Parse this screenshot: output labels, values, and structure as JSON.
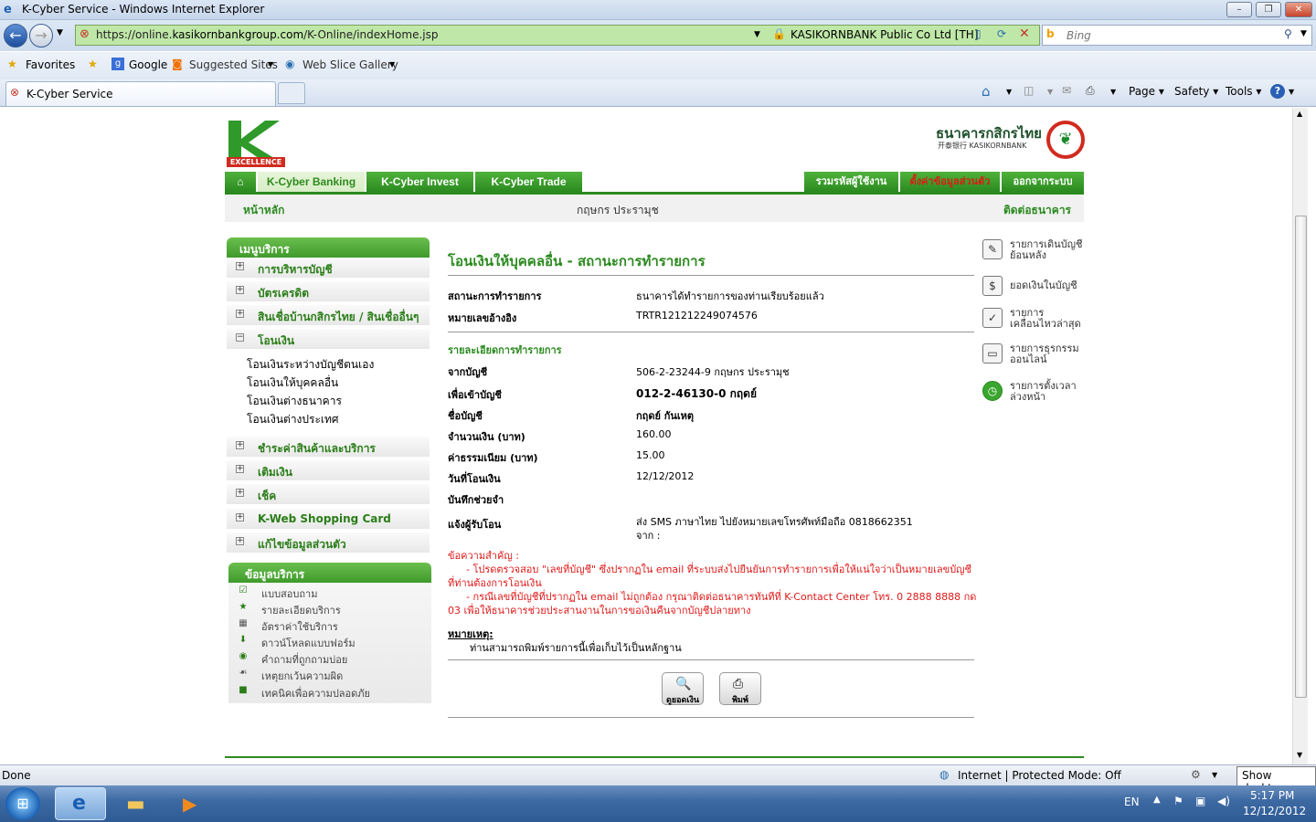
{
  "window": {
    "title": "K-Cyber Service - Windows Internet Explorer"
  },
  "browser": {
    "url_prefix": "https://online.",
    "url_domain": "kasikornbankgroup.com",
    "url_path": "/K-Online/indexHome.jsp",
    "cert": "KASIKORNBANK Public Co Ltd [TH]",
    "search_placeholder": "Bing",
    "favorites": "Favorites",
    "fav_items": [
      "Google",
      "Suggested Sites",
      "Web Slice Gallery"
    ],
    "tab_title": "K-Cyber Service",
    "commands": [
      "Page",
      "Safety",
      "Tools"
    ]
  },
  "bank": {
    "brand_sub": "EXCELLENCE",
    "name_th": "ธนาคารกสิกรไทย",
    "name_en": "开泰银行 KASIKORNBANK",
    "tabs": [
      "K-Cyber Banking",
      "K-Cyber Invest",
      "K-Cyber Trade"
    ],
    "right_tabs": [
      "รวมรหัสผู้ใช้งาน",
      "ตั้งค่าข้อมูลส่วนตัว",
      "ออกจากระบบ"
    ],
    "home_link": "หน้าหลัก",
    "user_name": "กฤษกร ประรามุช",
    "contact_link": "ติดต่อธนาคาร"
  },
  "menu": {
    "header": "เมนูบริการ",
    "items": [
      {
        "pm": "+",
        "label": "การบริหารบัญชี"
      },
      {
        "pm": "+",
        "label": "บัตรเครดิต"
      },
      {
        "pm": "+",
        "label": "สินเชื่อบ้านกสิกรไทย / สินเชื่ออื่นๆ"
      },
      {
        "pm": "−",
        "label": "โอนเงิน"
      }
    ],
    "subitems": [
      "โอนเงินระหว่างบัญชีตนเอง",
      "โอนเงินให้บุคคลอื่น",
      "โอนเงินต่างธนาคาร",
      "โอนเงินต่างประเทศ"
    ],
    "items2": [
      {
        "pm": "+",
        "label": "ชำระค่าสินค้าและบริการ"
      },
      {
        "pm": "+",
        "label": "เติมเงิน"
      },
      {
        "pm": "+",
        "label": "เช็ค"
      },
      {
        "pm": "+",
        "label": "K-Web Shopping Card"
      },
      {
        "pm": "+",
        "label": "แก้ไขข้อมูลส่วนตัว"
      }
    ]
  },
  "info": {
    "header": "ข้อมูลบริการ",
    "items": [
      "แบบสอบถาม",
      "รายละเอียดบริการ",
      "อัตราค่าใช้บริการ",
      "ดาวน์โหลดแบบฟอร์ม",
      "คำถามที่ถูกถามบ่อย",
      "เหตุยกเว้นความผิด",
      "เทคนิคเพื่อความปลอดภัย"
    ]
  },
  "main": {
    "title": "โอนเงินให้บุคคลอื่น - สถานะการทำรายการ",
    "status_label": "สถานะการทำรายการ",
    "status_value": "ธนาคารได้ทำรายการของท่านเรียบร้อยแล้ว",
    "ref_label": "หมายเลขอ้างอิง",
    "ref_value": "TRTR121212249074576",
    "detail_head": "รายละเอียดการทำรายการ",
    "from_label": "จากบัญชี",
    "from_value": "506-2-23244-9 กฤษกร  ประรามุช",
    "to_label": "เพื่อเข้าบัญชี",
    "to_value": "012-2-46130-0 กฤดย์",
    "name_label": "ชื่อบัญชี",
    "name_value": "กฤดย์ กันเหตุ",
    "amount_label": "จำนวนเงิน (บาท)",
    "amount_value": "160.00",
    "fee_label": "ค่าธรรมเนียม (บาท)",
    "fee_value": "15.00",
    "date_label": "วันที่โอนเงิน",
    "date_value": "12/12/2012",
    "memo_label": "บันทึกช่วยจำ",
    "notify_label": "แจ้งผู้รับโอน",
    "notify_value": "ส่ง  SMS ภาษาไทย  ไปยังหมายเลขโทรศัพท์มือถือ  0818662351",
    "notify_from": "จาก  :",
    "important_head": "ข้อความสำคัญ  :",
    "important_1": "- โปรดตรวจสอบ  \"เลขที่บัญชี\" ซึ่งปรากฏใน  email ที่ระบบส่งไปยืนยันการทำรายการเพื่อให้แน่ใจว่าเป็นหมายเลขบัญชีที่ท่านต้องการโอนเงิน",
    "important_2": "- กรณีเลขที่บัญชีที่ปรากฏใน  email ไม่ถูกต้อง  กรุณาติดต่อธนาคารทันทีที่  K-Contact Center โทร. 0 2888 8888 กด  03 เพื่อให้ธนาคารช่วยประสานงานในการขอเงินคืนจากบัญชีปลายทาง",
    "note_head": "หมายเหตุ:",
    "note_text": "ท่านสามารถพิมพ์รายการนี้เพื่อเก็บไว้เป็นหลักฐาน",
    "btn_balance": "ดูยอดเงิน",
    "btn_print": "พิมพ์"
  },
  "quicklinks": [
    "รายการเดินบัญชีย้อนหลัง",
    "ยอดเงินในบัญชี",
    "รายการเคลื่อนไหวล่าสุด",
    "รายการธุรกรรมออนไลน์",
    "รายการตั้งเวลาล่วงหน้า"
  ],
  "status": {
    "left": "Done",
    "zone": "Internet | Protected Mode: Off",
    "show_desktop": "Show desktop"
  },
  "taskbar": {
    "lang": "EN",
    "time": "5:17 PM",
    "date": "12/12/2012"
  }
}
